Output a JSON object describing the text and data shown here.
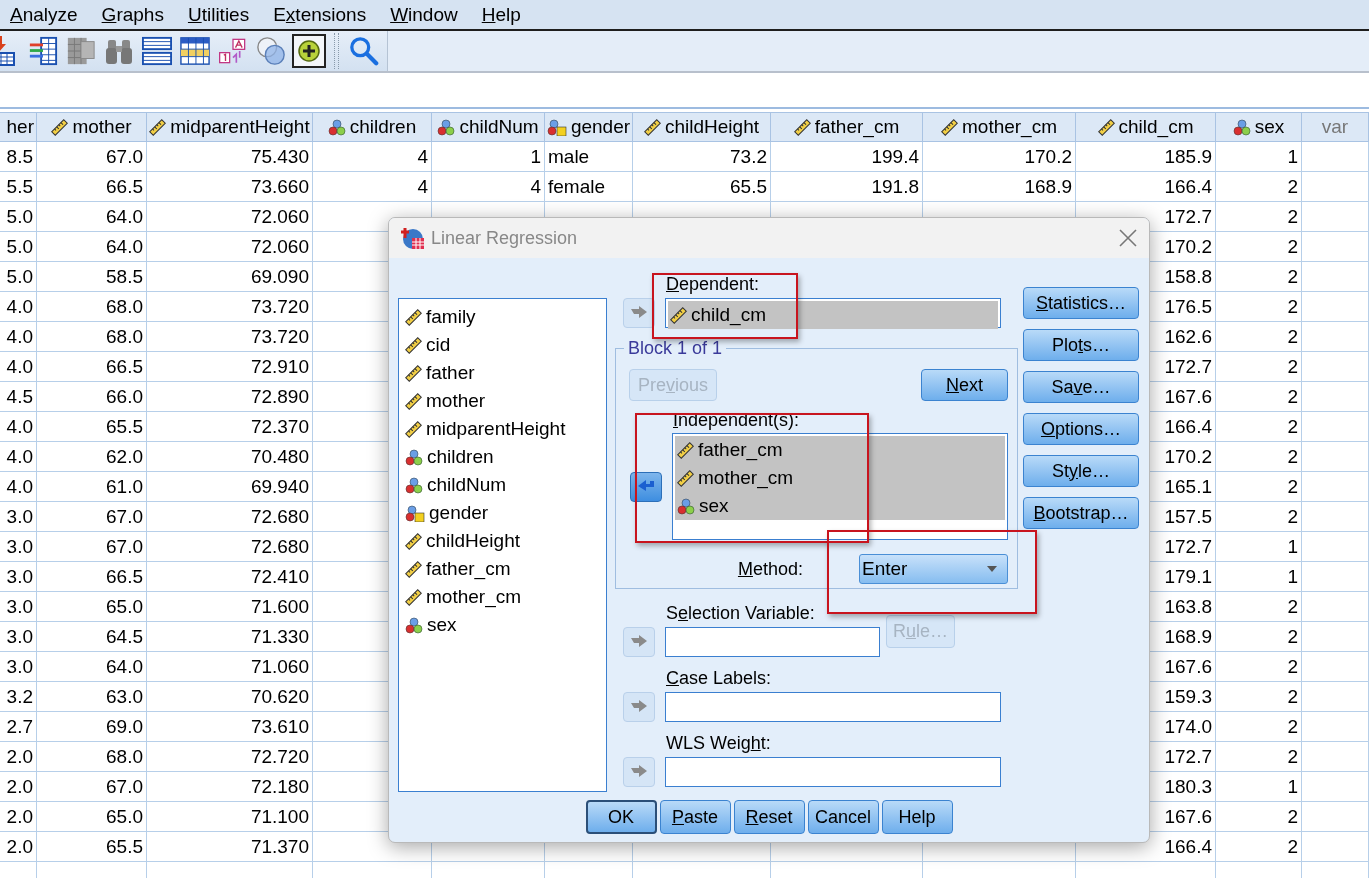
{
  "menu": [
    {
      "key": "A",
      "rest": "nalyze"
    },
    {
      "key": "G",
      "rest": "raphs"
    },
    {
      "key": "U",
      "rest": "tilities"
    },
    {
      "before": "E",
      "key": "x",
      "rest": "tensions"
    },
    {
      "key": "W",
      "rest": "indow"
    },
    {
      "key": "H",
      "rest": "elp"
    }
  ],
  "toolbar": {
    "groups": [
      [
        {
          "kind": "import",
          "pressed": false
        },
        {
          "kind": "variables",
          "pressed": false
        },
        {
          "kind": "mu-table",
          "pressed": false
        },
        {
          "kind": "binoculars",
          "pressed": false
        },
        {
          "kind": "split-table",
          "pressed": false
        },
        {
          "kind": "select-table",
          "pressed": false
        },
        {
          "kind": "value-labels",
          "pressed": false
        },
        {
          "kind": "sets",
          "pressed": false
        },
        {
          "kind": "addon",
          "pressed": true
        }
      ],
      [
        {
          "kind": "search",
          "pressed": false
        }
      ]
    ]
  },
  "table": {
    "columns": [
      {
        "name": "her",
        "kind": "none"
      },
      {
        "name": "mother",
        "kind": "scale"
      },
      {
        "name": "midparentHeight",
        "kind": "scale"
      },
      {
        "name": "children",
        "kind": "nominal"
      },
      {
        "name": "childNum",
        "kind": "nominal"
      },
      {
        "name": "gender",
        "kind": "string"
      },
      {
        "name": "childHeight",
        "kind": "scale"
      },
      {
        "name": "father_cm",
        "kind": "scale"
      },
      {
        "name": "mother_cm",
        "kind": "scale"
      },
      {
        "name": "child_cm",
        "kind": "scale"
      },
      {
        "name": "sex",
        "kind": "nominal"
      },
      {
        "name": "var",
        "kind": "empty"
      }
    ],
    "rows": [
      [
        "8.5",
        "67.0",
        "75.430",
        "4",
        "1",
        "male",
        "73.2",
        "199.4",
        "170.2",
        "185.9",
        "1",
        null
      ],
      [
        "5.5",
        "66.5",
        "73.660",
        "4",
        "4",
        "female",
        "65.5",
        "191.8",
        "168.9",
        "166.4",
        "2",
        null
      ],
      [
        "5.0",
        "64.0",
        "72.060",
        null,
        null,
        null,
        null,
        null,
        null,
        "172.7",
        "2",
        null
      ],
      [
        "5.0",
        "64.0",
        "72.060",
        null,
        null,
        null,
        null,
        null,
        null,
        "170.2",
        "2",
        null
      ],
      [
        "5.0",
        "58.5",
        "69.090",
        null,
        null,
        null,
        null,
        null,
        null,
        "158.8",
        "2",
        null
      ],
      [
        "4.0",
        "68.0",
        "73.720",
        null,
        null,
        null,
        null,
        null,
        null,
        "176.5",
        "2",
        null
      ],
      [
        "4.0",
        "68.0",
        "73.720",
        null,
        null,
        null,
        null,
        null,
        null,
        "162.6",
        "2",
        null
      ],
      [
        "4.0",
        "66.5",
        "72.910",
        null,
        null,
        null,
        null,
        null,
        null,
        "172.7",
        "2",
        null
      ],
      [
        "4.5",
        "66.0",
        "72.890",
        null,
        null,
        null,
        null,
        null,
        null,
        "167.6",
        "2",
        null
      ],
      [
        "4.0",
        "65.5",
        "72.370",
        null,
        null,
        null,
        null,
        null,
        null,
        "166.4",
        "2",
        null
      ],
      [
        "4.0",
        "62.0",
        "70.480",
        null,
        null,
        null,
        null,
        null,
        null,
        "170.2",
        "2",
        null
      ],
      [
        "4.0",
        "61.0",
        "69.940",
        null,
        null,
        null,
        null,
        null,
        null,
        "165.1",
        "2",
        null
      ],
      [
        "3.0",
        "67.0",
        "72.680",
        null,
        null,
        null,
        null,
        null,
        null,
        "157.5",
        "2",
        null
      ],
      [
        "3.0",
        "67.0",
        "72.680",
        null,
        null,
        null,
        null,
        null,
        null,
        "172.7",
        "1",
        null
      ],
      [
        "3.0",
        "66.5",
        "72.410",
        null,
        null,
        null,
        null,
        null,
        null,
        "179.1",
        "1",
        null
      ],
      [
        "3.0",
        "65.0",
        "71.600",
        null,
        null,
        null,
        null,
        null,
        null,
        "163.8",
        "2",
        null
      ],
      [
        "3.0",
        "64.5",
        "71.330",
        null,
        null,
        null,
        null,
        null,
        null,
        "168.9",
        "2",
        null
      ],
      [
        "3.0",
        "64.0",
        "71.060",
        null,
        null,
        null,
        null,
        null,
        null,
        "167.6",
        "2",
        null
      ],
      [
        "3.2",
        "63.0",
        "70.620",
        null,
        null,
        null,
        null,
        null,
        null,
        "159.3",
        "2",
        null
      ],
      [
        "2.7",
        "69.0",
        "73.610",
        null,
        null,
        null,
        null,
        null,
        null,
        "174.0",
        "2",
        null
      ],
      [
        "2.0",
        "68.0",
        "72.720",
        null,
        null,
        null,
        null,
        null,
        null,
        "172.7",
        "2",
        null
      ],
      [
        "2.0",
        "67.0",
        "72.180",
        null,
        null,
        null,
        null,
        null,
        null,
        "180.3",
        "1",
        null
      ],
      [
        "2.0",
        "65.0",
        "71.100",
        null,
        null,
        null,
        null,
        null,
        null,
        "167.6",
        "2",
        null
      ],
      [
        "2.0",
        "65.5",
        "71.370",
        null,
        null,
        null,
        null,
        null,
        null,
        "166.4",
        "2",
        null
      ]
    ]
  },
  "dialog": {
    "title": "Linear Regression",
    "source_variables": [
      {
        "name": "family",
        "kind": "scale"
      },
      {
        "name": "cid",
        "kind": "scale"
      },
      {
        "name": "father",
        "kind": "scale"
      },
      {
        "name": "mother",
        "kind": "scale"
      },
      {
        "name": "midparentHeight",
        "kind": "scale"
      },
      {
        "name": "children",
        "kind": "nominal"
      },
      {
        "name": "childNum",
        "kind": "nominal"
      },
      {
        "name": "gender",
        "kind": "string"
      },
      {
        "name": "childHeight",
        "kind": "scale"
      },
      {
        "name": "father_cm",
        "kind": "scale"
      },
      {
        "name": "mother_cm",
        "kind": "scale"
      },
      {
        "name": "sex",
        "kind": "nominal"
      }
    ],
    "dependent": {
      "label": {
        "key": "D",
        "rest": "ependent:"
      },
      "arrow": {
        "active": false
      },
      "items": [
        {
          "name": "child_cm",
          "kind": "scale",
          "selected": true
        }
      ]
    },
    "block": {
      "title": "Block 1 of 1",
      "previous": {
        "label": {
          "before": "Pre",
          "key": "v",
          "rest": "ious"
        },
        "disabled": true
      },
      "next": {
        "label": {
          "key": "N",
          "rest": "ext"
        },
        "disabled": false
      },
      "independents_label": {
        "key": "I",
        "rest": "ndependent(s):"
      },
      "arrow": {
        "active": true
      },
      "independents": [
        {
          "name": "father_cm",
          "kind": "scale",
          "selected": true
        },
        {
          "name": "mother_cm",
          "kind": "scale",
          "selected": true
        },
        {
          "name": "sex",
          "kind": "nominal",
          "selected": true
        }
      ],
      "method_label": {
        "key": "M",
        "rest": "ethod:"
      },
      "method": "Enter"
    },
    "selection": {
      "label": {
        "before": "S",
        "key": "e",
        "rest": "lection Variable:"
      },
      "arrow": {
        "active": false
      },
      "rule": {
        "label": {
          "before": "R",
          "key": "u",
          "rest": "le…"
        },
        "disabled": true
      }
    },
    "case_labels": {
      "label": {
        "key": "C",
        "rest": "ase Labels:"
      },
      "arrow": {
        "active": false
      }
    },
    "wls_weight": {
      "label": {
        "before": "WLS Weig",
        "key": "h",
        "rest": "t:"
      },
      "arrow": {
        "active": false
      }
    },
    "side_buttons": [
      {
        "key": "S",
        "rest": "tatistics…"
      },
      {
        "before": "Plo",
        "key": "t",
        "rest": "s…"
      },
      {
        "before": "Sa",
        "key": "v",
        "rest": "e…"
      },
      {
        "key": "O",
        "rest": "ptions…"
      },
      {
        "before": "St",
        "key": "y",
        "rest": "le…"
      },
      {
        "key": "B",
        "rest": "ootstrap…"
      }
    ],
    "footer_buttons": [
      {
        "label": {
          "text": "OK"
        },
        "default": true
      },
      {
        "label": {
          "key": "P",
          "rest": "aste"
        },
        "default": false
      },
      {
        "label": {
          "key": "R",
          "rest": "eset"
        },
        "default": false
      },
      {
        "label": {
          "text": "Cancel"
        },
        "default": false
      },
      {
        "label": {
          "text": "Help"
        },
        "default": false
      }
    ]
  }
}
